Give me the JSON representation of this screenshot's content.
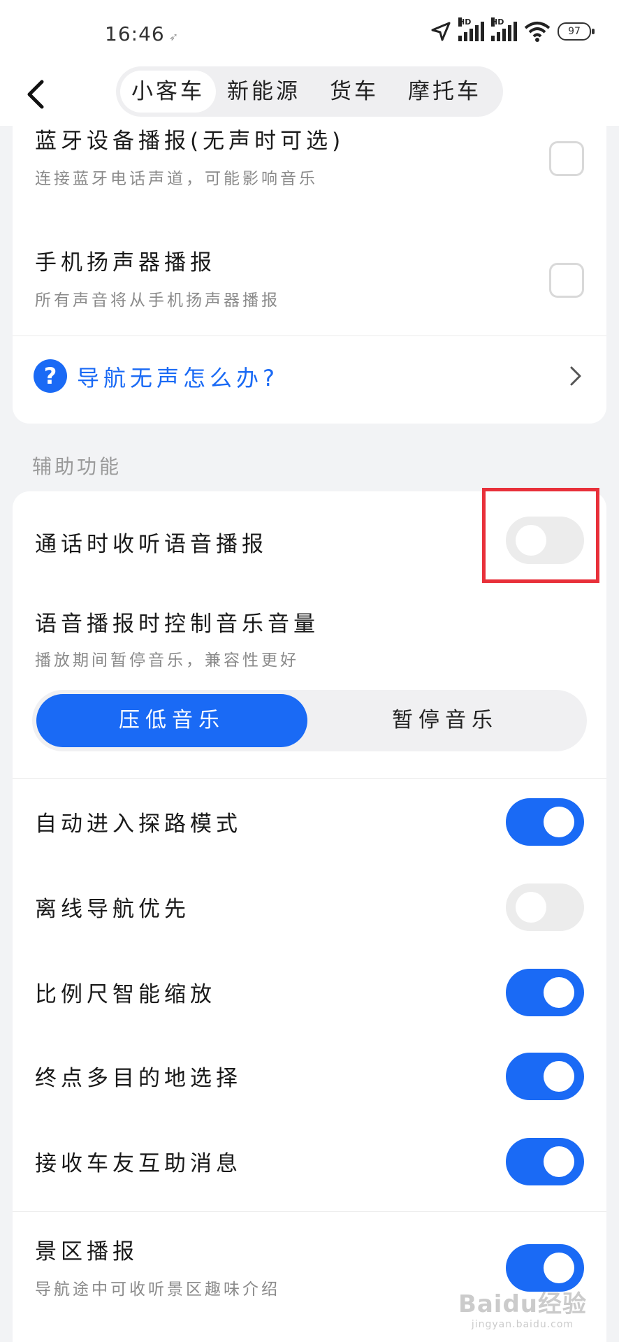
{
  "status_bar": {
    "time": "16:46",
    "hd_label": "HD",
    "battery": "97"
  },
  "nav": {
    "tabs": [
      {
        "label": "小客车",
        "active": true
      },
      {
        "label": "新能源",
        "active": false
      },
      {
        "label": "货车",
        "active": false
      },
      {
        "label": "摩托车",
        "active": false
      }
    ]
  },
  "voice_output": {
    "bluetooth": {
      "title": "蓝牙设备播报(无声时可选)",
      "subtitle": "连接蓝牙电话声道，可能影响音乐",
      "checked": false
    },
    "speaker": {
      "title": "手机扬声器播报",
      "subtitle": "所有声音将从手机扬声器播报",
      "checked": false
    },
    "help_link": "导航无声怎么办?"
  },
  "assist": {
    "section_label": "辅助功能",
    "call_listen": {
      "title": "通话时收听语音播报",
      "on": false
    },
    "music_control": {
      "title": "语音播报时控制音乐音量",
      "subtitle": "播放期间暂停音乐，兼容性更好",
      "options": [
        {
          "label": "压低音乐",
          "active": true
        },
        {
          "label": "暂停音乐",
          "active": false
        }
      ]
    },
    "toggles": [
      {
        "label": "自动进入探路模式",
        "on": true
      },
      {
        "label": "离线导航优先",
        "on": false
      },
      {
        "label": "比例尺智能缩放",
        "on": true
      },
      {
        "label": "终点多目的地选择",
        "on": true
      },
      {
        "label": "接收车友互助消息",
        "on": true
      }
    ],
    "scenic": {
      "title": "景区播报",
      "subtitle": "导航途中可收听景区趣味介绍",
      "on": true
    }
  },
  "watermark": {
    "text": "Baidu经验",
    "sub": "jingyan.baidu.com"
  },
  "colors": {
    "accent": "#1a6af5",
    "highlight": "#e8303a",
    "background": "#f2f3f5"
  }
}
